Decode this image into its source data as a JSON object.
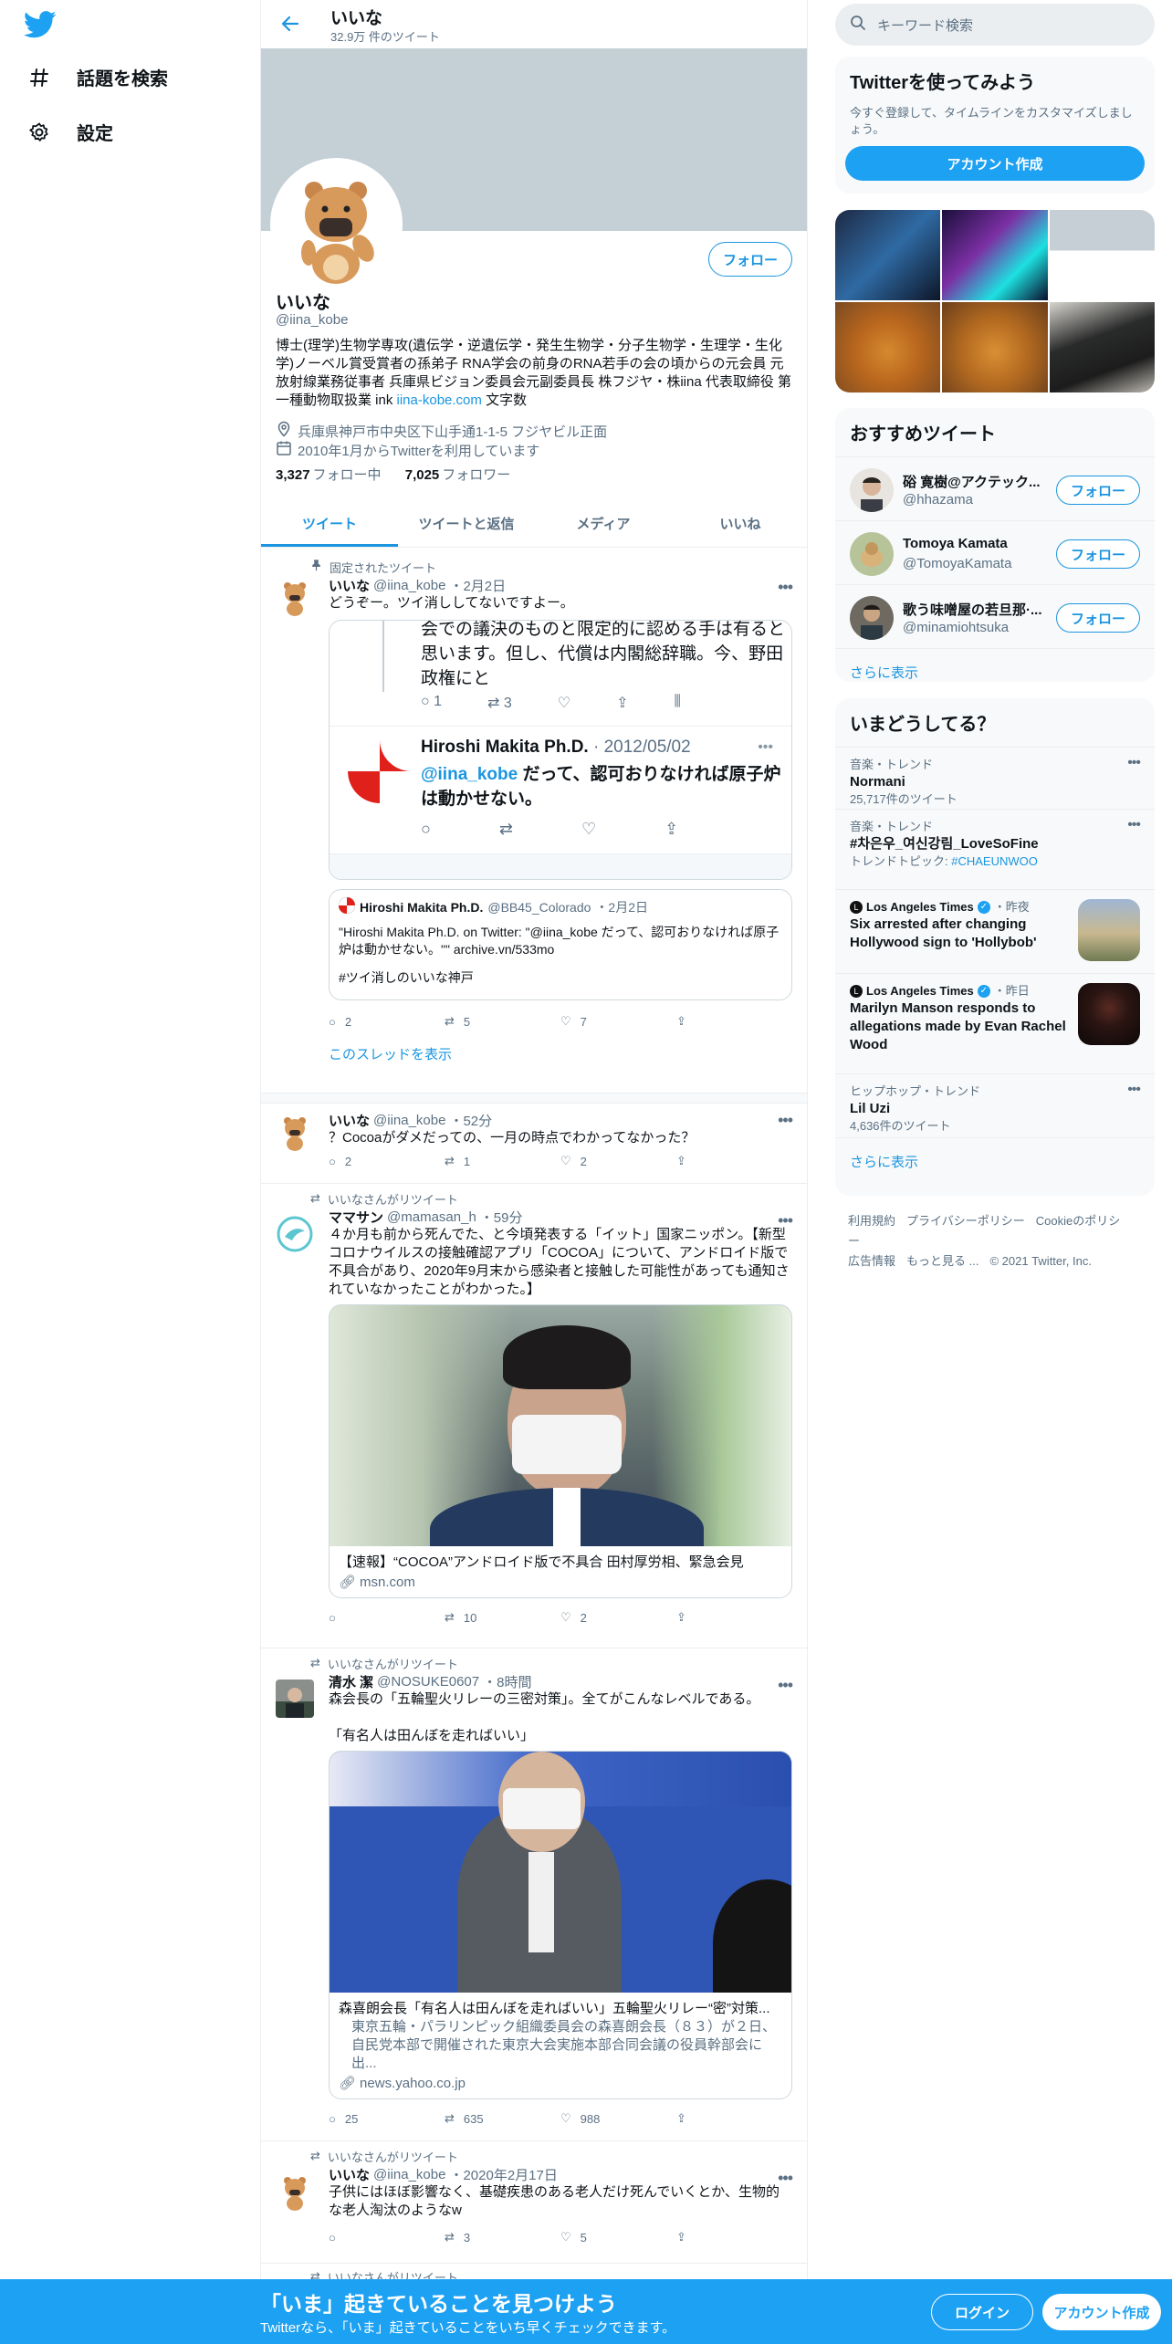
{
  "nav": {
    "explore": "話題を検索",
    "settings": "設定"
  },
  "header": {
    "name": "いいな",
    "tweet_count": "32.9万 件のツイート"
  },
  "profile": {
    "follow": "フォロー",
    "name": "いいな",
    "handle": "@iina_kobe",
    "bio": "博士(理学)生物学専攻(遺伝学・逆遺伝学・発生生物学・分子生物学・生理学・生化学)ノーベル賞受賞者の孫弟子 RNA学会の前身のRNA若手の会の頃からの元会員 元放射線業務従事者 兵庫県ビジョン委員会元副委員長 株フジヤ・株iina 代表取締役 第一種動物取扱業 ink",
    "bio_link": "iina-kobe.com",
    "bio_tail": " 文字数",
    "location": "兵庫県神戸市中央区下山手通1-1-5 フジヤビル正面",
    "joined": "2010年1月からTwitterを利用しています",
    "following_count": "3,327",
    "following_label": "フォロー中",
    "followers_count": "7,025",
    "followers_label": "フォロワー"
  },
  "tabs": [
    "ツイート",
    "ツイートと返信",
    "メディア",
    "いいね"
  ],
  "tweets": {
    "t1": {
      "pinned": "固定されたツイート",
      "name": "いいな",
      "handle": "@iina_kobe",
      "time": "・2月2日",
      "text": "どうぞー。ツイ消ししてないですよー。",
      "embed_text": "会での議決のものと限定的に認める手は有ると思います。但し、代償は内閣総辞職。今、野田政権にと",
      "embed_reply": "1",
      "embed_rt": "3",
      "embed2_name": "Hiroshi Makita Ph.D.",
      "embed2_date": "· 2012/05/02",
      "embed2_mention": "@iina_kobe",
      "embed2_text": " だって、認可おりなければ原子炉は動かせない。",
      "quote_name": "Hiroshi Makita Ph.D.",
      "quote_handle": "@BB45_Colorado",
      "quote_time": "・2月2日",
      "quote_text1": "\"Hiroshi Makita Ph.D. on Twitter: \"@iina_kobe だって、認可おりなければ原子炉は動かせない。\"\" archive.vn/533mo",
      "quote_text2": "#ツイ消しのいいな神戸",
      "reply": "2",
      "rt": "5",
      "like": "7",
      "thread": "このスレッドを表示"
    },
    "t2": {
      "name": "いいな",
      "handle": "@iina_kobe",
      "time": "・52分",
      "text": "？Cocoaがダメだっての、一月の時点でわかってなかった？",
      "reply": "2",
      "rt": "1",
      "like": "2"
    },
    "t3": {
      "ctx": "いいなさんがリツイート",
      "name": "ママサン",
      "handle": "@mamasan_h",
      "time": "・59分",
      "text": "４か月も前から死んでた、と今頃発表する「イット」国家ニッポン。【新型コロナウイルスの接触確認アプリ「COCOA」について、アンドロイド版で不具合があり、2020年9月末から感染者と接触した可能性があっても通知されていなかったことがわかった。】",
      "card_title": "【速報】“COCOA”アンドロイド版で不具合 田村厚労相、緊急会見",
      "card_domain": "msn.com",
      "reply": "",
      "rt": "10",
      "like": "2"
    },
    "t4": {
      "ctx": "いいなさんがリツイート",
      "name": "清水 潔",
      "handle": "@NOSUKE0607",
      "time": "・8時間",
      "text": "森会長の「五輪聖火リレーの三密対策」。全てがこんなレベルである。",
      "text2": "「有名人は田んぼを走ればいい」",
      "card_title": "森喜朗会長「有名人は田んぼを走ればいい」五輪聖火リレー“密”対策...",
      "card_desc": "東京五輪・パラリンピック組織委員会の森喜朗会長（８３）が２日、自民党本部で開催された東京大会実施本部合同会議の役員幹部会に出...",
      "card_domain": "news.yahoo.co.jp",
      "reply": "25",
      "rt": "635",
      "like": "988"
    },
    "t5": {
      "ctx": "いいなさんがリツイート",
      "name": "いいな",
      "handle": "@iina_kobe",
      "time": "・2020年2月17日",
      "text": "子供にはほぼ影響なく、基礎疾患のある老人だけ死んでいくとか、生物的な老人淘汰のようなw",
      "reply": "",
      "rt": "3",
      "like": "5"
    },
    "t6": {
      "ctx": "いいなさんがリツイート"
    }
  },
  "right": {
    "search_placeholder": "キーワード検索",
    "signup_title": "Twitterを使ってみよう",
    "signup_desc": "今すぐ登録して、タイムラインをカスタマイズしましょう。",
    "signup_button": "アカウント作成",
    "who_title": "おすすめツイート",
    "who": [
      {
        "name": "硲 寛樹@アクテック...",
        "handle": "@hhazama",
        "button": "フォロー"
      },
      {
        "name": "Tomoya Kamata",
        "handle": "@TomoyaKamata",
        "button": "フォロー"
      },
      {
        "name": "歌う味噌屋の若旦那·...",
        "handle": "@minamiohtsuka",
        "button": "フォロー"
      }
    ],
    "who_more": "さらに表示",
    "trends_title": "いまどうしてる？",
    "trends": [
      {
        "meta": "音楽・トレンド",
        "name": "Normani",
        "count": "25,717件のツイート"
      },
      {
        "meta": "音楽・トレンド",
        "name": "#차은우_여신강림_LoveSoFine",
        "sub_prefix": "トレンドトピック: ",
        "sub_link": "#CHAEUNWOO"
      },
      {
        "source": "Los Angeles Times",
        "time": "・昨夜",
        "name": "Six arrested after changing Hollywood sign to 'Hollybob'"
      },
      {
        "source": "Los Angeles Times",
        "time": "・昨日",
        "name": "Marilyn Manson responds to allegations made by Evan Rachel Wood"
      },
      {
        "meta": "ヒップホップ・トレンド",
        "name": "Lil Uzi",
        "count": "4,636件のツイート"
      }
    ],
    "trends_more": "さらに表示",
    "footer": [
      "利用規約",
      "プライバシーポリシー",
      "Cookieのポリシー",
      "広告情報",
      "もっと見る ...",
      "© 2021 Twitter, Inc."
    ]
  },
  "bottom": {
    "title": "「いま」起きていることを見つけよう",
    "subtitle": "Twitterなら、「いま」起きていることをいち早くチェックできます。",
    "login": "ログイン",
    "signup": "アカウント作成"
  },
  "colors": {
    "accent": "#1da1f2",
    "link": "#1b95e0",
    "banner": "#c4cfd6"
  }
}
